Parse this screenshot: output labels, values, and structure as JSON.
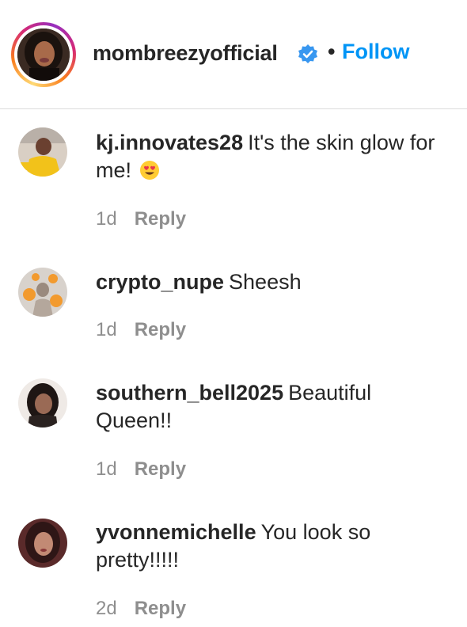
{
  "post_owner": {
    "username": "mombreezyofficial",
    "verified_icon": "verified-badge-icon",
    "separator": "•",
    "follow_label": "Follow",
    "accent_color": "#0095f6"
  },
  "comments": [
    {
      "username": "kj.innovates28",
      "text": "It's the skin glow for me!",
      "emoji": "heart-eyes-emoji",
      "time": "1d",
      "reply_label": "Reply"
    },
    {
      "username": "crypto_nupe",
      "text": "Sheesh",
      "time": "1d",
      "reply_label": "Reply"
    },
    {
      "username": "southern_bell2025",
      "text": "Beautiful Queen!!",
      "time": "1d",
      "reply_label": "Reply"
    },
    {
      "username": "yvonnemichelle",
      "text": "You look so pretty!!!!!",
      "time": "2d",
      "reply_label": "Reply"
    }
  ]
}
